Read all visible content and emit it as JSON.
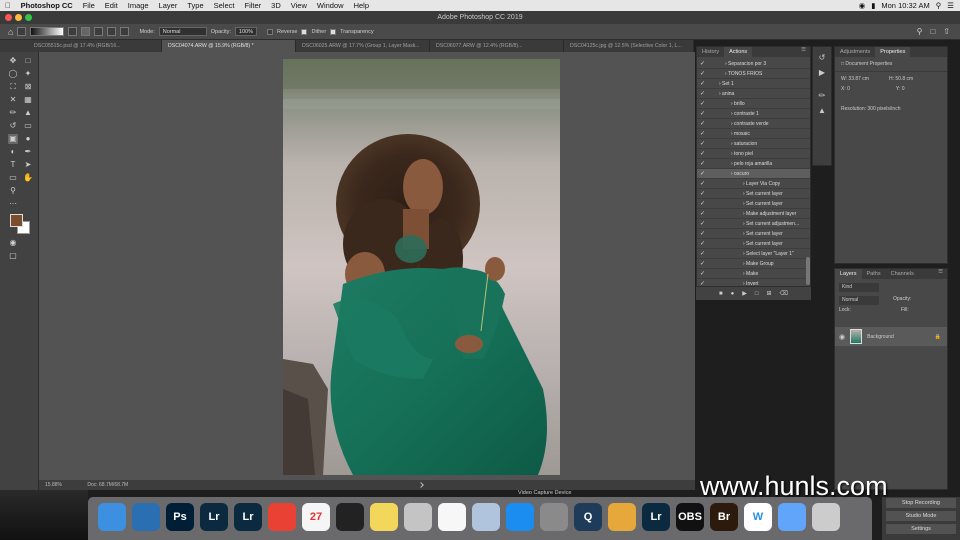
{
  "menubar": {
    "apple": "",
    "app_name": "Photoshop CC",
    "items": [
      "File",
      "Edit",
      "Image",
      "Layer",
      "Type",
      "Select",
      "Filter",
      "3D",
      "View",
      "Window",
      "Help"
    ],
    "datetime": "Mon 10:32 AM"
  },
  "window": {
    "title": "Adobe Photoshop CC 2019"
  },
  "options": {
    "mode_label": "Mode:",
    "mode_value": "Normal",
    "opacity_label": "Opacity:",
    "opacity_value": "100%",
    "reverse": "Reverse",
    "dither": "Dither",
    "transparency": "Transparency"
  },
  "tabs": [
    "DSC05515c.psd @ 17.4% (RGB/16...",
    "DSC04074.ARW @ 15.9% (RGB/8) *",
    "DSC06025.ARW @ 17.7% (Group 1, Layer Mask...",
    "DSC06077.ARW @ 12.4% (RGB/8)...",
    "DSC04125c.jpg @ 12.5% (Selective Color 1, L..."
  ],
  "status": {
    "zoom": "15.88%",
    "doc": "Doc: 68.7M/68.7M"
  },
  "actions_panel": {
    "tabs": [
      "History",
      "Actions"
    ],
    "rows": [
      "Separacion por 3",
      "TONOS FRIOS",
      "Set 1",
      "anina",
      "brillo",
      "contraste 1",
      "contraste verde",
      "mosaic",
      "saturacion",
      "tono piel",
      "pelo roja amarilla",
      "oscuro",
      "Layer Via Copy",
      "Set current layer",
      "Set current layer",
      "Make adjustment layer",
      "Set current adjustmen...",
      "Set current layer",
      "Set current layer",
      "Select layer \"Layer 1\"",
      "Make Group",
      "Make",
      "Invert"
    ]
  },
  "properties_panel": {
    "tabs": [
      "Adjustments",
      "Properties"
    ],
    "header": "Document Properties",
    "w": "W: 33.87 cm",
    "h": "H: 50.8 cm",
    "x": "X: 0",
    "y": "Y: 0",
    "resolution": "Resolution: 300 pixels/inch"
  },
  "layers_panel": {
    "tabs": [
      "Layers",
      "Paths",
      "Channels"
    ],
    "kind": "Kind",
    "blend": "Normal",
    "opacity": "Opacity:",
    "lock": "Lock:",
    "fill": "Fill:",
    "layer_name": "Background"
  },
  "watermark": "www.hunls.com",
  "obs": {
    "buttons": [
      "Stop Recording",
      "Studio Mode",
      "Settings"
    ],
    "bg_text": "Video Capture Device"
  },
  "dock": [
    "Finder",
    "1Password",
    "Ps",
    "Lr",
    "Lr",
    "Chrome",
    "27",
    "Final Cut",
    "Notes",
    "Photo",
    "Reminders",
    "Preview",
    "App Store",
    "Preferences",
    "Q",
    "Screens",
    "Lr",
    "OBS",
    "Br",
    "W",
    "Folder",
    "Trash"
  ],
  "colors": {
    "accent": "#2e8f77",
    "dress": "#1e7a62",
    "ps_blue": "#31a8ff"
  }
}
